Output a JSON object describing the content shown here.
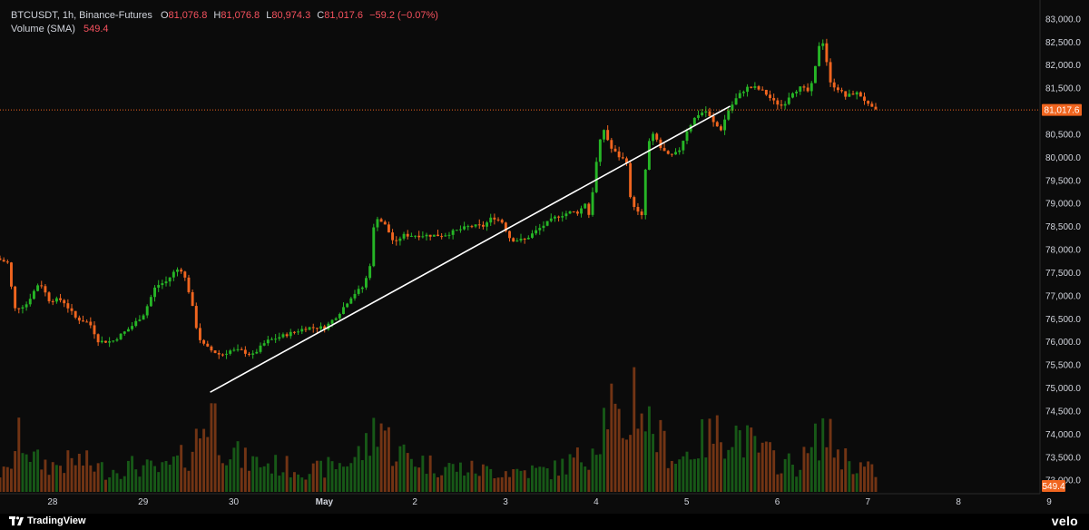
{
  "header": {
    "symbol": "BTCUSDT, 1h, Binance-Futures",
    "open_label": "O",
    "open": "81,076.8",
    "high_label": "H",
    "high": "81,076.8",
    "low_label": "L",
    "low": "80,974.3",
    "close_label": "C",
    "close": "81,017.6",
    "change": "−59.2 (−0.07%)",
    "volume_label": "Volume (SMA)",
    "volume_value": "549.4"
  },
  "footer": {
    "brand": "TradingView",
    "watermark": "velo"
  },
  "colors": {
    "background": "#0b0b0b",
    "up": "#26b526",
    "down": "#f0651f",
    "price_line": "#f0651f",
    "trendline": "#ffffff",
    "axis_text": "#d1d4dc"
  },
  "chart_data": {
    "type": "candlestick",
    "interval": "1h",
    "y_axis": {
      "ticks": [
        "83,000.0",
        "82,500.0",
        "82,000.0",
        "81,500.0",
        "81,000.0",
        "80,500.0",
        "80,000.0",
        "79,500.0",
        "79,000.0",
        "78,500.0",
        "78,000.0",
        "77,500.0",
        "77,000.0",
        "76,500.0",
        "76,000.0",
        "75,500.0",
        "75,000.0",
        "74,500.0",
        "74,000.0",
        "73,500.0",
        "73,000.0"
      ],
      "range": [
        72700,
        83400
      ]
    },
    "x_axis": {
      "ticks": [
        "28",
        "29",
        "30",
        "May",
        "2",
        "3",
        "4",
        "5",
        "6",
        "7",
        "8",
        "9"
      ],
      "tick_days": [
        0,
        1,
        2,
        3,
        4,
        5,
        6,
        7,
        8,
        9,
        10,
        11
      ],
      "range_days": [
        -0.58,
        10.9
      ]
    },
    "current_price_label": "81,017.6",
    "current_price": 81017.6,
    "volume_label": "549.4",
    "trendline": {
      "from": {
        "day": 1.74,
        "price": 74900
      },
      "to": {
        "day": 7.48,
        "price": 81100
      }
    },
    "price_path": [
      [
        -0.58,
        77800
      ],
      [
        -0.45,
        77700
      ],
      [
        -0.38,
        76700
      ],
      [
        -0.25,
        76800
      ],
      [
        -0.1,
        77300
      ],
      [
        0.0,
        76900
      ],
      [
        0.15,
        76900
      ],
      [
        0.3,
        76500
      ],
      [
        0.45,
        76400
      ],
      [
        0.55,
        76000
      ],
      [
        0.7,
        76000
      ],
      [
        0.9,
        76300
      ],
      [
        1.05,
        76600
      ],
      [
        1.18,
        77200
      ],
      [
        1.3,
        77300
      ],
      [
        1.38,
        77500
      ],
      [
        1.45,
        77600
      ],
      [
        1.52,
        77300
      ],
      [
        1.58,
        76800
      ],
      [
        1.65,
        76100
      ],
      [
        1.72,
        75900
      ],
      [
        1.8,
        75800
      ],
      [
        1.9,
        75700
      ],
      [
        2.0,
        75800
      ],
      [
        2.12,
        75800
      ],
      [
        2.25,
        75700
      ],
      [
        2.4,
        76000
      ],
      [
        2.55,
        76100
      ],
      [
        2.7,
        76200
      ],
      [
        2.85,
        76300
      ],
      [
        3.05,
        76300
      ],
      [
        3.2,
        76600
      ],
      [
        3.35,
        77000
      ],
      [
        3.48,
        77200
      ],
      [
        3.55,
        77700
      ],
      [
        3.58,
        78400
      ],
      [
        3.62,
        78700
      ],
      [
        3.72,
        78500
      ],
      [
        3.82,
        78100
      ],
      [
        3.9,
        78300
      ],
      [
        4.05,
        78300
      ],
      [
        4.2,
        78300
      ],
      [
        4.35,
        78300
      ],
      [
        4.5,
        78400
      ],
      [
        4.65,
        78500
      ],
      [
        4.8,
        78500
      ],
      [
        4.9,
        78700
      ],
      [
        5.0,
        78600
      ],
      [
        5.1,
        78200
      ],
      [
        5.25,
        78200
      ],
      [
        5.45,
        78500
      ],
      [
        5.6,
        78700
      ],
      [
        5.75,
        78800
      ],
      [
        5.85,
        78800
      ],
      [
        5.92,
        79000
      ],
      [
        5.97,
        78700
      ],
      [
        6.03,
        79700
      ],
      [
        6.08,
        80300
      ],
      [
        6.13,
        80600
      ],
      [
        6.2,
        80200
      ],
      [
        6.3,
        80000
      ],
      [
        6.38,
        79900
      ],
      [
        6.42,
        79100
      ],
      [
        6.5,
        78800
      ],
      [
        6.55,
        78700
      ],
      [
        6.58,
        79600
      ],
      [
        6.62,
        80300
      ],
      [
        6.68,
        80500
      ],
      [
        6.75,
        80200
      ],
      [
        6.85,
        80000
      ],
      [
        6.95,
        80100
      ],
      [
        7.05,
        80600
      ],
      [
        7.15,
        80900
      ],
      [
        7.25,
        81000
      ],
      [
        7.35,
        80700
      ],
      [
        7.42,
        80600
      ],
      [
        7.5,
        81000
      ],
      [
        7.6,
        81300
      ],
      [
        7.7,
        81500
      ],
      [
        7.8,
        81500
      ],
      [
        7.9,
        81400
      ],
      [
        8.0,
        81200
      ],
      [
        8.1,
        81100
      ],
      [
        8.2,
        81400
      ],
      [
        8.3,
        81500
      ],
      [
        8.4,
        81400
      ],
      [
        8.45,
        81800
      ],
      [
        8.5,
        82400
      ],
      [
        8.53,
        82600
      ],
      [
        8.57,
        82300
      ],
      [
        8.62,
        81600
      ],
      [
        8.7,
        81500
      ],
      [
        8.8,
        81300
      ],
      [
        8.9,
        81400
      ],
      [
        8.98,
        81300
      ],
      [
        9.05,
        81100
      ],
      [
        9.12,
        81000
      ]
    ],
    "volume_shape": [
      [
        -0.5,
        0.18
      ],
      [
        -0.35,
        0.55
      ],
      [
        -0.2,
        0.3
      ],
      [
        0.0,
        0.25
      ],
      [
        0.3,
        0.3
      ],
      [
        0.6,
        0.2
      ],
      [
        0.9,
        0.25
      ],
      [
        1.2,
        0.2
      ],
      [
        1.5,
        0.35
      ],
      [
        1.65,
        0.6
      ],
      [
        1.75,
        0.85
      ],
      [
        1.85,
        0.5
      ],
      [
        2.1,
        0.3
      ],
      [
        2.5,
        0.25
      ],
      [
        2.9,
        0.2
      ],
      [
        3.3,
        0.3
      ],
      [
        3.5,
        0.45
      ],
      [
        3.6,
        0.75
      ],
      [
        3.75,
        0.4
      ],
      [
        4.2,
        0.25
      ],
      [
        4.8,
        0.2
      ],
      [
        5.0,
        0.2
      ],
      [
        5.5,
        0.2
      ],
      [
        5.9,
        0.35
      ],
      [
        6.05,
        0.6
      ],
      [
        6.15,
        0.9
      ],
      [
        6.3,
        0.4
      ],
      [
        6.42,
        1.0
      ],
      [
        6.55,
        0.7
      ],
      [
        6.7,
        0.5
      ],
      [
        6.9,
        0.3
      ],
      [
        7.2,
        0.5
      ],
      [
        7.5,
        0.6
      ],
      [
        7.7,
        0.45
      ],
      [
        8.0,
        0.3
      ],
      [
        8.2,
        0.25
      ],
      [
        8.35,
        0.35
      ],
      [
        8.5,
        0.6
      ],
      [
        8.7,
        0.35
      ],
      [
        8.9,
        0.25
      ],
      [
        9.1,
        0.18
      ]
    ]
  }
}
